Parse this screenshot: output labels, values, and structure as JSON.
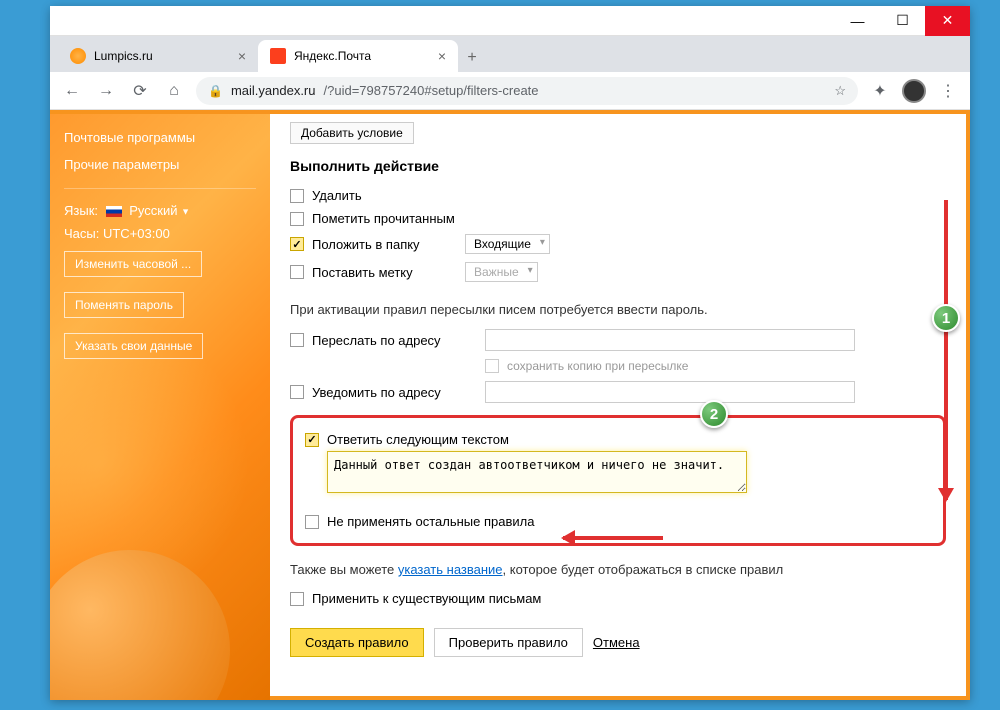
{
  "window": {
    "min": "—",
    "max": "☐",
    "close": "✕"
  },
  "tabs": [
    {
      "title": "Lumpics.ru",
      "active": false
    },
    {
      "title": "Яндекс.Почта",
      "active": true
    }
  ],
  "address": {
    "host": "mail.yandex.ru",
    "path": "/?uid=798757240#setup/filters-create"
  },
  "sidebar": {
    "links": [
      "Почтовые программы",
      "Прочие параметры"
    ],
    "lang_label": "Язык:",
    "lang_value": "Русский",
    "tz_label": "Часы: UTC+03:00",
    "btns": [
      "Изменить часовой ...",
      "Поменять пароль",
      "Указать свои данные"
    ]
  },
  "main": {
    "add_condition": "Добавить условие",
    "section_action": "Выполнить действие",
    "actions": {
      "delete": "Удалить",
      "mark_read": "Пометить прочитанным",
      "put_folder": "Положить в папку",
      "folder_value": "Входящие",
      "set_label": "Поставить метку",
      "label_value": "Важные"
    },
    "forward_hint": "При активации правил пересылки писем потребуется ввести пароль.",
    "forward": "Переслать по адресу",
    "save_copy": "сохранить копию при пересылке",
    "notify": "Уведомить по адресу",
    "reply_text_label": "Ответить следующим текстом",
    "reply_text_value": "Данный ответ создан автоответчиком и ничего не значит.",
    "stop_rules": "Не применять остальные правила",
    "also_text_pre": "Также вы можете ",
    "also_link": "указать название",
    "also_text_post": ", которое будет отображаться в списке правил",
    "apply_existing": "Применить к существующим письмам",
    "btn_create": "Создать правило",
    "btn_check": "Проверить правило",
    "btn_cancel": "Отмена"
  },
  "badges": {
    "one": "1",
    "two": "2"
  }
}
